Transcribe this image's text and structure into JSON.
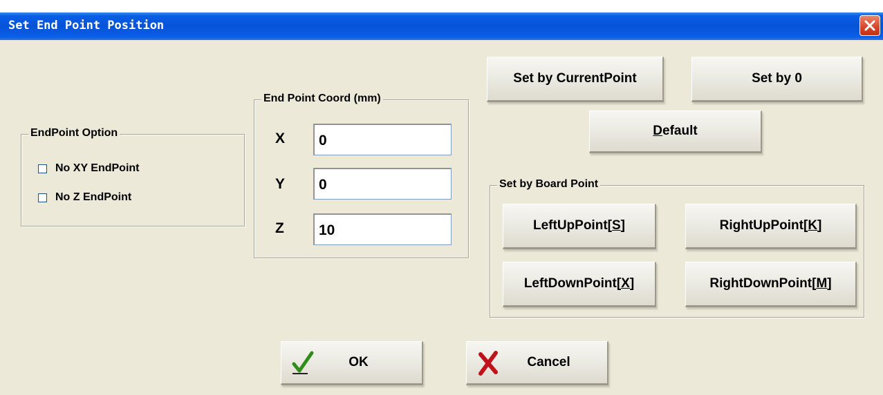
{
  "window": {
    "title": "Set End Point Position"
  },
  "endpoint_option": {
    "legend": "EndPoint Option",
    "no_xy": "No XY EndPoint",
    "no_z": "No Z EndPoint"
  },
  "coord": {
    "legend": "End Point Coord (mm)",
    "x_label": "X",
    "x_value": "0",
    "y_label": "Y",
    "y_value": "0",
    "z_label": "Z",
    "z_value": "10"
  },
  "buttons": {
    "set_current": "Set by CurrentPoint",
    "set_zero": "Set by 0",
    "default_pre": "",
    "default_ul": "D",
    "default_post": "efault"
  },
  "board": {
    "legend": "Set by Board Point",
    "left_up_pre": "LeftUpPoint[",
    "left_up_ul": "S",
    "right_up_pre": "RightUpPoint[",
    "right_up_ul": "K",
    "left_down_pre": "LeftDownPoint[",
    "left_down_ul": "X",
    "right_down_pre": "RightDownPoint[",
    "right_down_ul": "M",
    "close": "]"
  },
  "footer": {
    "ok": "OK",
    "cancel": "Cancel"
  }
}
